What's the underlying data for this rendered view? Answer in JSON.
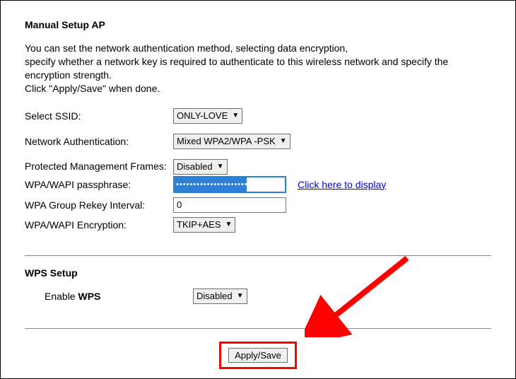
{
  "title": "Manual Setup AP",
  "intro_lines": [
    "You can set the network authentication method, selecting data encryption,",
    "specify whether a network key is required to authenticate to this wireless network and specify the encryption strength.",
    "Click \"Apply/Save\" when done."
  ],
  "fields": {
    "ssid_label": "Select SSID:",
    "ssid_value": "ONLY-LOVE",
    "auth_label": "Network Authentication:",
    "auth_value": "Mixed WPA2/WPA -PSK",
    "pmf_label": "Protected Management Frames:",
    "pmf_value": "Disabled",
    "passphrase_label": "WPA/WAPI passphrase:",
    "passphrase_masked": "••••••••••••••••••••••",
    "display_link": "Click here to display",
    "rekey_label": "WPA Group Rekey Interval:",
    "rekey_value": "0",
    "encryption_label": "WPA/WAPI Encryption:",
    "encryption_value": "TKIP+AES"
  },
  "wps": {
    "section_title": "WPS Setup",
    "enable_label_prefix": "Enable ",
    "enable_label_bold": "WPS",
    "enable_value": "Disabled"
  },
  "apply_button": "Apply/Save",
  "colors": {
    "highlight_red": "#ff0000",
    "link_blue": "#0000ee",
    "select_blue": "#2f7fd4"
  }
}
